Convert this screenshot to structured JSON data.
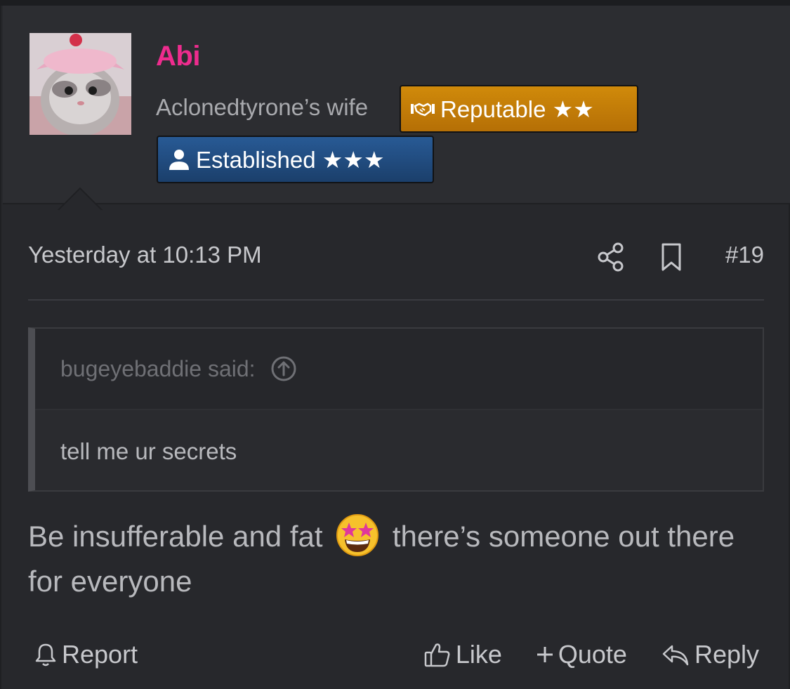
{
  "user": {
    "name": "Abi",
    "title": "Aclonedtyrone’s wife",
    "avatar_icon": "kitten-avatar",
    "badges": [
      {
        "label": "Reputable ★★",
        "icon": "handshake-icon",
        "color": "#c98006"
      },
      {
        "label": "Established ★★★",
        "icon": "user-icon",
        "color": "#23508a"
      }
    ]
  },
  "post": {
    "timestamp": "Yesterday at 10:13 PM",
    "number": "#19",
    "quote": {
      "author": "bugeyebaddie said:",
      "text": "tell me ur secrets"
    },
    "message_part1": "Be insufferable and fat",
    "message_part2": "there’s someone out there for everyone",
    "emoji": "star-struck-emoji"
  },
  "actions": {
    "report": "Report",
    "like": "Like",
    "quote": "Quote",
    "reply": "Reply"
  },
  "colors": {
    "username": "#ee2c8e",
    "background": "#27282c"
  }
}
